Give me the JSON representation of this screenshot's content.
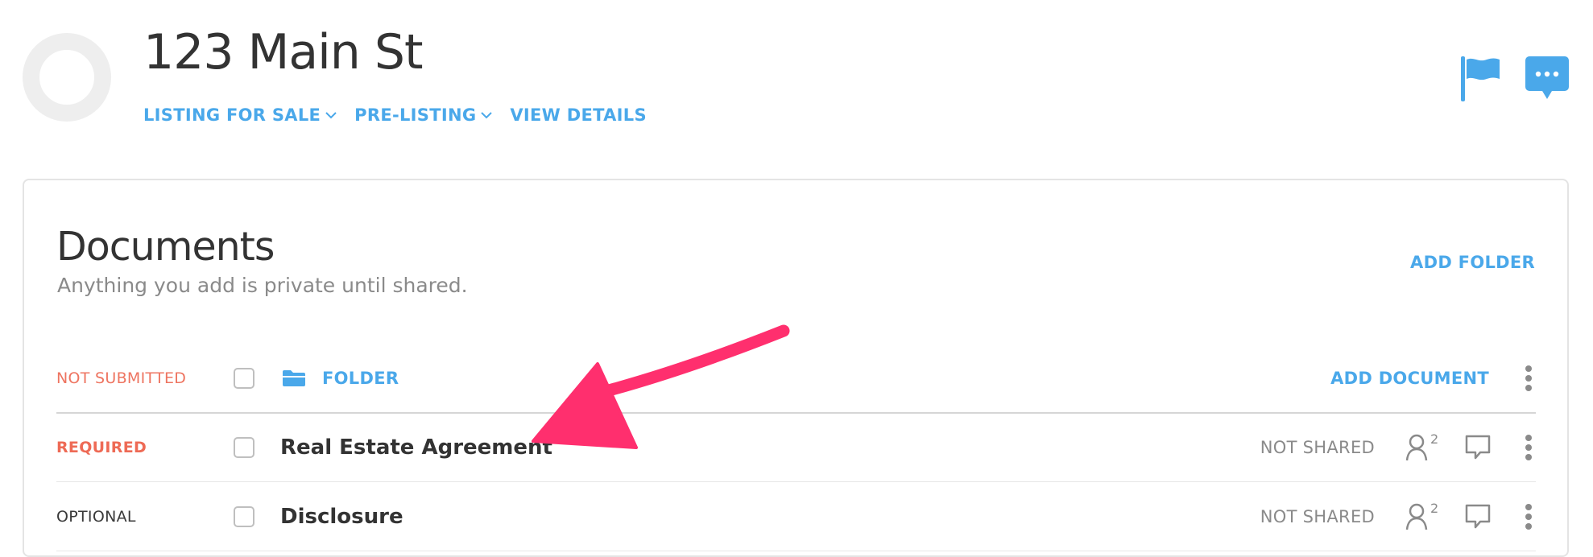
{
  "header": {
    "title": "123 Main St",
    "subnav": [
      {
        "label": "LISTING FOR SALE",
        "has_dropdown": true
      },
      {
        "label": "PRE-LISTING",
        "has_dropdown": true
      },
      {
        "label": "VIEW DETAILS",
        "has_dropdown": false
      }
    ],
    "actions": [
      {
        "icon": "flag-icon"
      },
      {
        "icon": "chat-bubble-icon"
      }
    ]
  },
  "documents": {
    "title": "Documents",
    "subtitle": "Anything you add is private until shared.",
    "add_folder_label": "ADD FOLDER",
    "folder_row": {
      "status": "NOT SUBMITTED",
      "folder_label": "FOLDER",
      "add_document_label": "ADD DOCUMENT"
    },
    "rows": [
      {
        "status": "REQUIRED",
        "name": "Real Estate Agreement",
        "share_status": "NOT SHARED",
        "people_count": "2"
      },
      {
        "status": "OPTIONAL",
        "name": "Disclosure",
        "share_status": "NOT SHARED",
        "people_count": "2"
      }
    ]
  },
  "colors": {
    "accent": "#4aa8ea",
    "status_red": "#ee6a55",
    "annotation_arrow": "#ff2f6e"
  }
}
